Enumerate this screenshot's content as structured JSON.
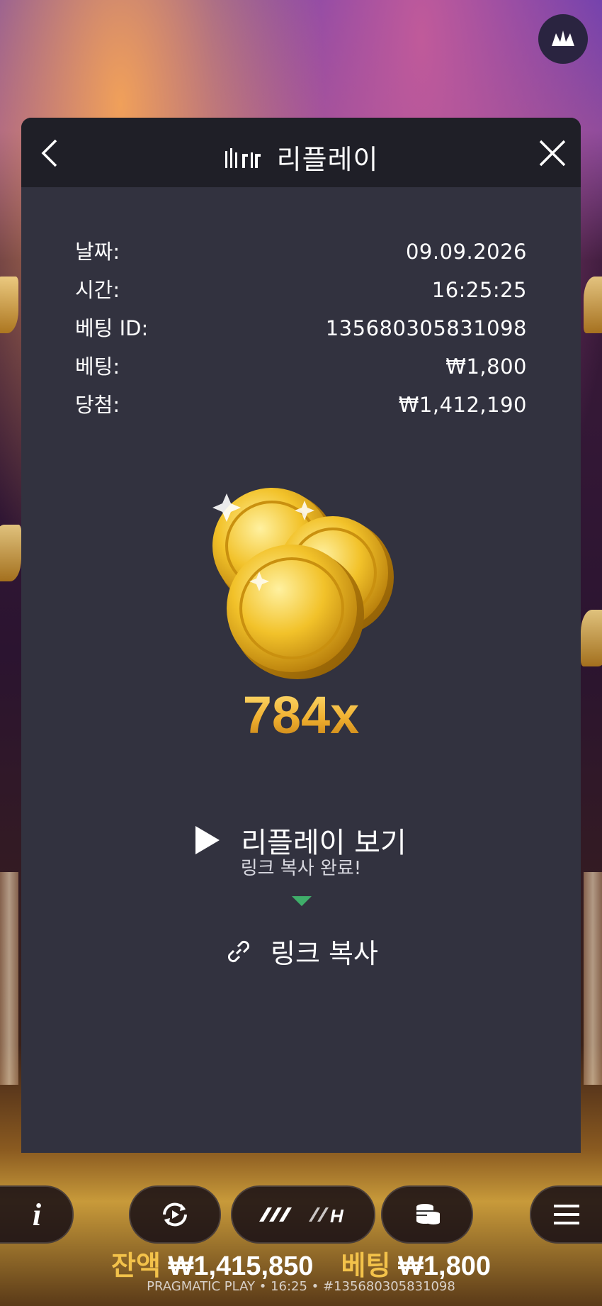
{
  "modal": {
    "title": "리플레이",
    "info": [
      {
        "label": "날짜:",
        "value": "09.09.2026"
      },
      {
        "label": "시간:",
        "value": "16:25:25"
      },
      {
        "label": "베팅 ID:",
        "value": "135680305831098"
      },
      {
        "label": "베팅:",
        "value": "₩1,800"
      },
      {
        "label": "당첨:",
        "value": "₩1,412,190"
      }
    ],
    "multiplier": "784x",
    "replay_label": "리플레이 보기",
    "toast": "링크 복사 완료!",
    "copy_label": "링크 복사"
  },
  "status": {
    "balance_label": "잔액",
    "balance_value": "₩1,415,850",
    "bet_label": "베팅",
    "bet_value": "₩1,800",
    "footer": "PRAGMATIC PLAY • 16:25 • #135680305831098"
  },
  "colors": {
    "modal_bg": "#32323f",
    "header_bg": "#1f1f27",
    "gold": "#f3c24a",
    "toast_arrow": "#3fae6a"
  }
}
